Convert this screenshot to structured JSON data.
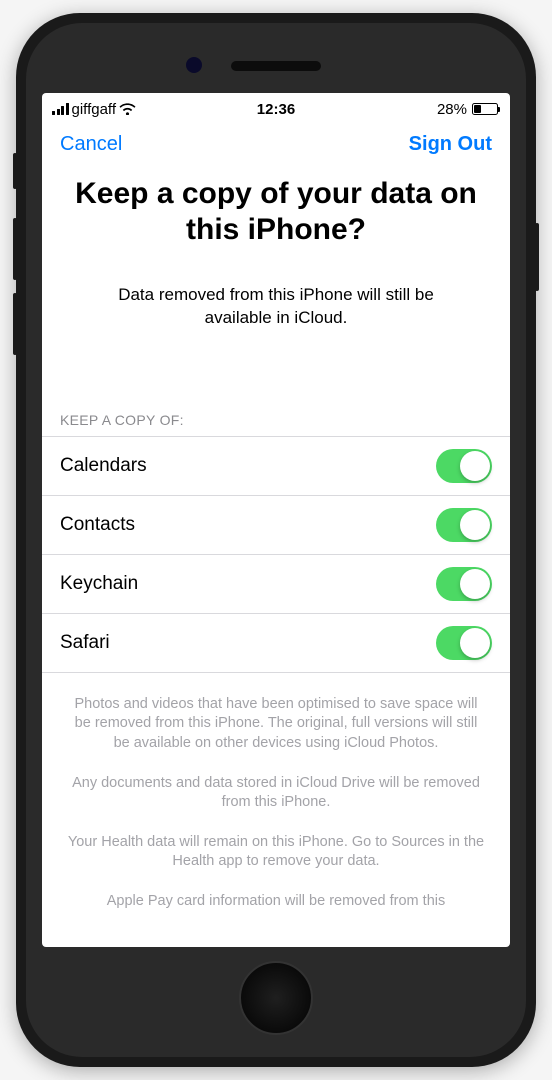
{
  "statusbar": {
    "carrier": "giffgaff",
    "time": "12:36",
    "battery_pct": "28%"
  },
  "nav": {
    "cancel": "Cancel",
    "signout": "Sign Out"
  },
  "heading": {
    "title": "Keep a copy of your data on this iPhone?",
    "subtitle": "Data removed from this iPhone will still be available in iCloud."
  },
  "section_header": "KEEP A COPY OF:",
  "items": [
    {
      "label": "Calendars",
      "on": true
    },
    {
      "label": "Contacts",
      "on": true
    },
    {
      "label": "Keychain",
      "on": true
    },
    {
      "label": "Safari",
      "on": true
    }
  ],
  "footer": [
    "Photos and videos that have been optimised to save space will be removed from this iPhone. The original, full versions will still be available on other devices using iCloud Photos.",
    "Any documents and data stored in iCloud Drive will be removed from this iPhone.",
    "Your Health data will remain on this iPhone. Go to Sources in the Health app to remove your data.",
    "Apple Pay card information will be removed from this"
  ]
}
